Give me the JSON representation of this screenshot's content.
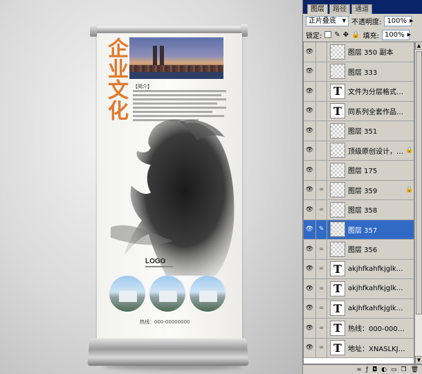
{
  "canvas": {
    "banner": {
      "calligraphy": "企业文化",
      "intro_title": "【简介】",
      "logo_text": "LOGO",
      "hotline": "热线：000-00000000"
    }
  },
  "panel": {
    "tabs": [
      {
        "label": "图层",
        "active": true
      },
      {
        "label": "路径",
        "active": false
      },
      {
        "label": "通道",
        "active": false
      }
    ],
    "blend_mode": "正片叠底",
    "opacity_label": "不透明度:",
    "opacity_value": "100%",
    "lock_label": "锁定:",
    "fill_label": "填充:",
    "fill_value": "100%",
    "layers": [
      {
        "name": "图层 350 副本",
        "type": "image",
        "locked": false,
        "selected": false
      },
      {
        "name": "图层 333",
        "type": "image",
        "locked": false,
        "selected": false
      },
      {
        "name": "文件为分层格式 C...",
        "type": "text",
        "locked": false,
        "selected": false
      },
      {
        "name": "同系列全套作品可...",
        "type": "text",
        "locked": false,
        "selected": false
      },
      {
        "name": "图层 351",
        "type": "image",
        "locked": false,
        "selected": false
      },
      {
        "name": "顶级原创设计，请...",
        "type": "image",
        "locked": true,
        "selected": false
      },
      {
        "name": "图层 175",
        "type": "image",
        "locked": false,
        "selected": false
      },
      {
        "name": "图层 359",
        "type": "image",
        "locked": true,
        "selected": false
      },
      {
        "name": "图层 358",
        "type": "image",
        "locked": false,
        "selected": false
      },
      {
        "name": "图层 357",
        "type": "image",
        "locked": false,
        "selected": true
      },
      {
        "name": "图层 356",
        "type": "image",
        "locked": false,
        "selected": false
      },
      {
        "name": "akjhfkahfkjglksjljs...",
        "type": "text",
        "locked": false,
        "selected": false
      },
      {
        "name": "akjhfkahfkjglksjljs...",
        "type": "text",
        "locked": false,
        "selected": false
      },
      {
        "name": "akjhfkahfkjglksjljs...",
        "type": "text",
        "locked": false,
        "selected": false
      },
      {
        "name": "热线：000-00000...",
        "type": "text",
        "locked": false,
        "selected": false
      },
      {
        "name": "地址：XNASLKJFS...",
        "type": "text",
        "locked": false,
        "selected": false
      }
    ],
    "colors": {
      "selection": "#316ac5",
      "titlebar": "#0a246a",
      "panel_bg": "#d4d0c8"
    }
  }
}
